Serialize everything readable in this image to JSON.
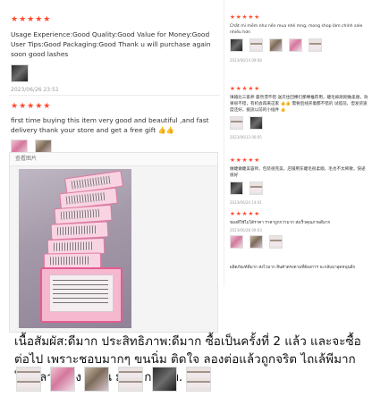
{
  "left_reviews": [
    {
      "stars": "★★★★★",
      "text": "Usage Experience:Good Quality:Good Value for Money:Good User Tips:Good Packaging:Good Thank u will purchase again soon good lashes",
      "date": "2023/06/26 23:51"
    },
    {
      "stars": "★★★★★",
      "text": "first time buying this item very good and beautiful ,and fast delivery thank your store and get a free gift 👍👍"
    }
  ],
  "photo_panel": {
    "header": "查看图片"
  },
  "thai_review": {
    "text": "เนื้อสัมผัส:ดีมาก ประสิทธิภาพ:ดีมาก ซื้อเป็นครั้งที่ 2 แล้ว และจะซื้อต่อไป เพราะชอบมากๆ ขนนิ่ม ติดใจ ลองต่อแล้วถูกจริต ไถเล้พีมาก ใช้เวลารของ 6 วัน มาจาก ตปท."
  },
  "right_reviews": [
    {
      "stars": "★★★★★",
      "text": "Chất mi mềm như nên mua nhé mng, mong shop làm chính sale nhiều hơn",
      "date": "2023/06/14 09:08"
    },
    {
      "stars": "★★★★★",
      "text": "填箱比三家养 最然漂不错 送次住回棵们那棵推荐用，睫毛嫁刚刚做柔顺，效果很不错，有机会再来这家 👍👍 需要后线买着都不错的 试提前，但发货速度还好，据說以前的小插件 👍",
      "date": "2023/06/13 00:05"
    },
    {
      "stars": "★★★★★",
      "text": "做睫做睫美容师，包装很完美，店铺用东睫毛很柔顺，毛也不太稀散，快递很好",
      "date": "2023/06/24 14:41"
    },
    {
      "stars": "★★★★★",
      "text": "ของดีใช้ไม่ได้ราคา ราคาถูกกว่ามาก ส่งเร็วคุณภาพดีมาก",
      "date": "2023/06/28 09:03"
    },
    {
      "stars": "",
      "text": "ผลิตภัณฑ์ดีมาก ส่งไวมาก สินค้าตรงตามที่ต้องการ จะกลับมาอุดหนุนอีก"
    }
  ]
}
